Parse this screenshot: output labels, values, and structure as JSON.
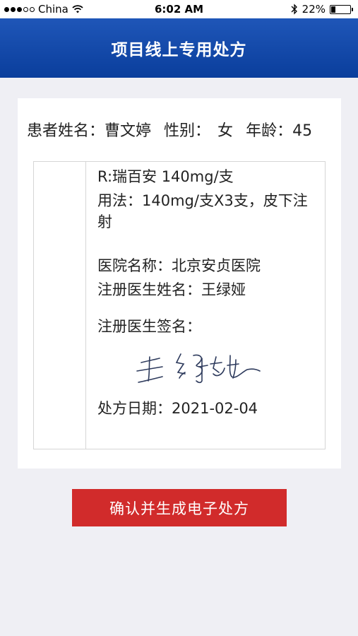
{
  "status_bar": {
    "carrier": "China",
    "time": "6:02 AM",
    "battery_percent": "22%",
    "battery_level": 0.22
  },
  "header": {
    "title": "项目线上专用处方"
  },
  "patient": {
    "name_label": "患者姓名：",
    "name": "曹文婷",
    "gender_label": "性别：",
    "gender": "女",
    "age_label": "年龄：",
    "age": "45"
  },
  "prescription": {
    "drug": "R:瑞百安 140mg/支",
    "usage": "用法：140mg/支X3支，皮下注射",
    "hospital": "医院名称：北京安贞医院",
    "doctor": "注册医生姓名：王绿娅",
    "signature_label": "注册医生签名：",
    "date": "处方日期：2021-02-04"
  },
  "actions": {
    "confirm_label": "确认并生成电子处方"
  },
  "colors": {
    "header_blue": "#0a3e9c",
    "button_red": "#d12b2b"
  }
}
